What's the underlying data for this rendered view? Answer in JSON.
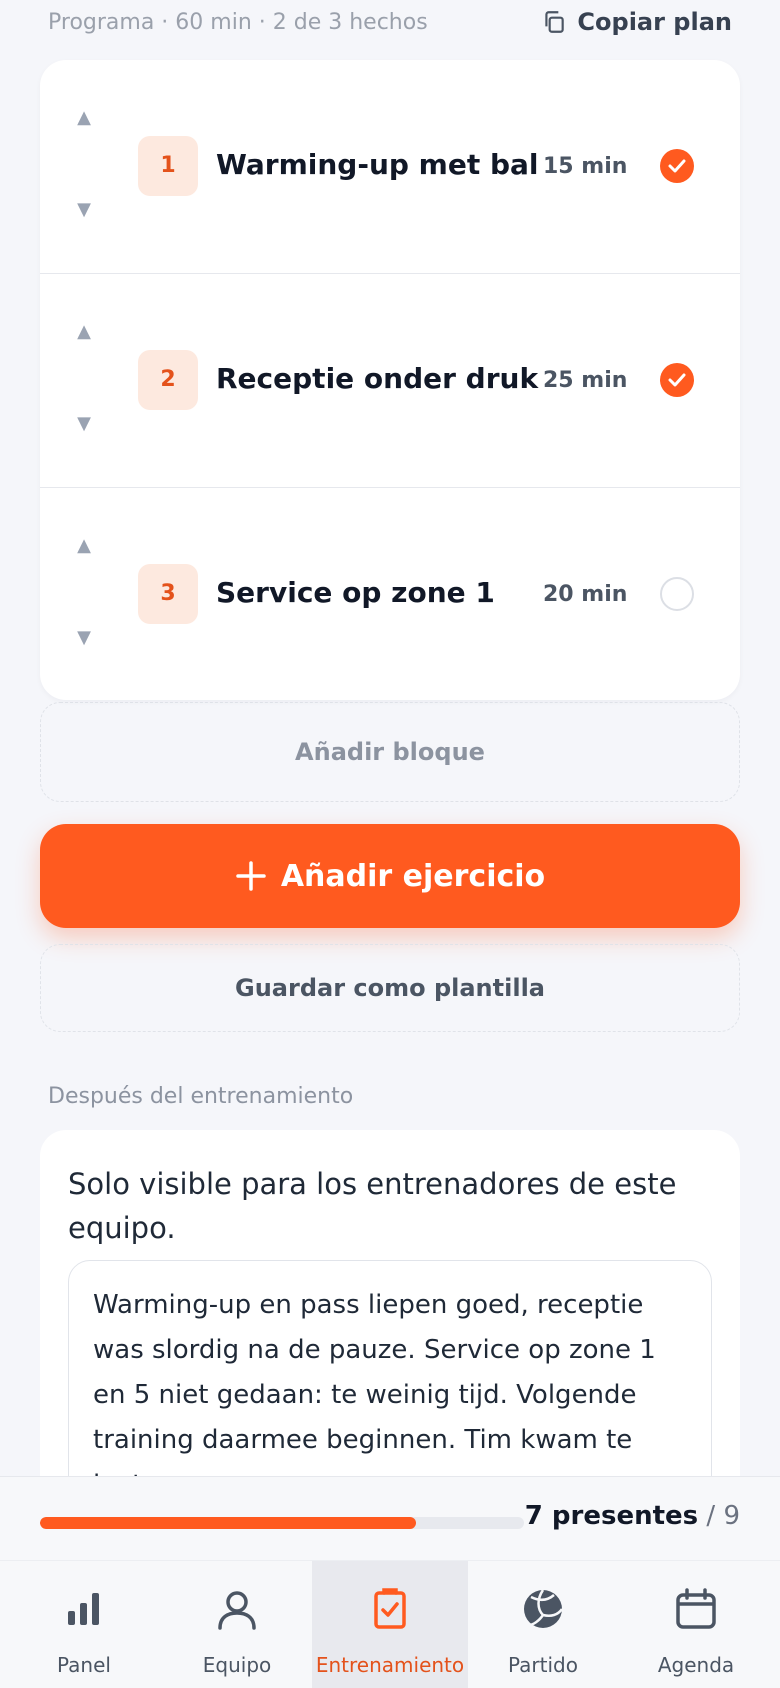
{
  "header": {
    "summary": "Programa · 60 min · 2 de 3 hechos",
    "copy_label": "Copiar plan"
  },
  "exercises": [
    {
      "number": "1",
      "name": "Warming-up met bal",
      "duration": "15 min",
      "done": true
    },
    {
      "number": "2",
      "name": "Receptie onder druk",
      "duration": "25 min",
      "done": true
    },
    {
      "number": "3",
      "name": "Service op zone 1",
      "duration": "20 min",
      "done": false
    }
  ],
  "actions": {
    "add_block": "Añadir bloque",
    "add_exercise": "Añadir ejercicio",
    "save_template": "Guardar como plantilla"
  },
  "after_training": {
    "label": "Después del entrenamiento",
    "visibility_info": "Solo visible para los entrenadores de este equipo.",
    "notes": "Warming-up en pass liepen goed, receptie was slordig na de pauze. Service op zone 1 en 5 niet gedaan: te weinig tijd. Volgende training daarmee beginnen. Tim kwam te laat,"
  },
  "attendance": {
    "present_label": "7 presentes",
    "total_label": "/ 9",
    "present": 7,
    "total": 9
  },
  "nav": [
    {
      "label": "Panel",
      "icon": "chart-icon",
      "active": false
    },
    {
      "label": "Equipo",
      "icon": "person-icon",
      "active": false
    },
    {
      "label": "Entrenamiento",
      "icon": "clipboard-check-icon",
      "active": true
    },
    {
      "label": "Partido",
      "icon": "volleyball-icon",
      "active": false
    },
    {
      "label": "Agenda",
      "icon": "calendar-icon",
      "active": false
    }
  ],
  "colors": {
    "accent": "#ff5a1f",
    "background": "#f5f6fa",
    "card": "#ffffff",
    "muted": "#8c93a0"
  }
}
